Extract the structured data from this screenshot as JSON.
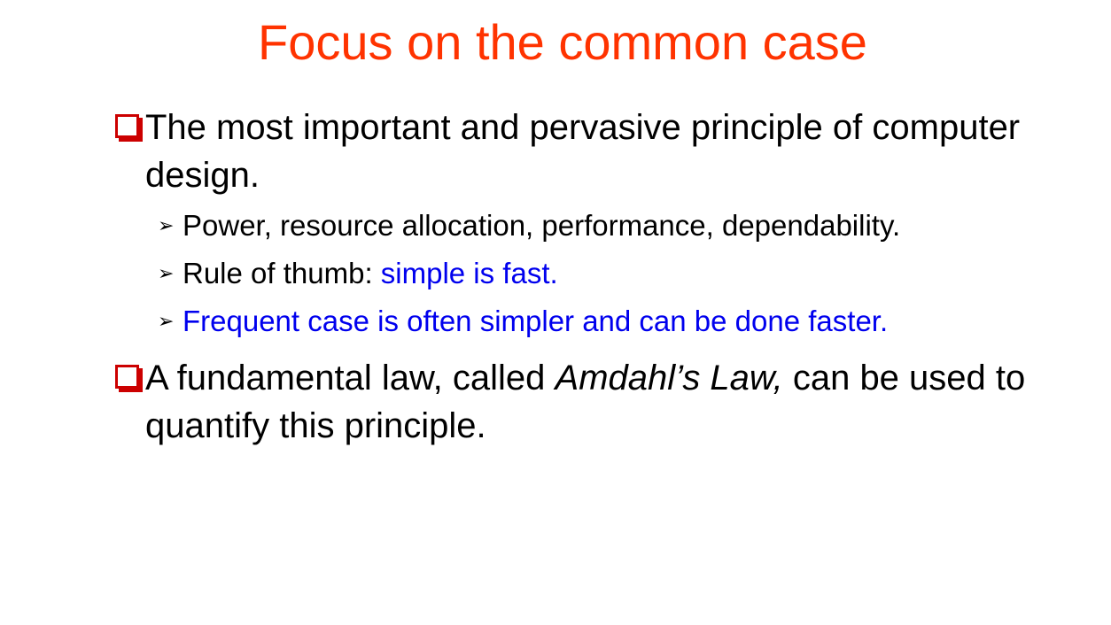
{
  "slide": {
    "title": "Focus on the common case",
    "bullets": [
      {
        "text": "The most important and pervasive principle of computer design."
      },
      {
        "text_before": "A fundamental law, called ",
        "emphasis": "Amdahl’s Law,",
        "text_after": " can be used to quantify this principle."
      }
    ],
    "sub_bullets": [
      {
        "text": "Power, resource allocation, performance, dependability."
      },
      {
        "text": "Rule of thumb:  ",
        "highlight": "simple is fast."
      },
      {
        "text": "Frequent case is often simpler and can be done faster."
      }
    ]
  },
  "colors": {
    "title": "#ff3300",
    "bullet_box": "#cc0000",
    "highlight": "#0000ee",
    "text": "#000000"
  },
  "icons": {
    "bullet": "hollow-square-with-shadow",
    "sub_bullet": "arrowhead-right"
  }
}
